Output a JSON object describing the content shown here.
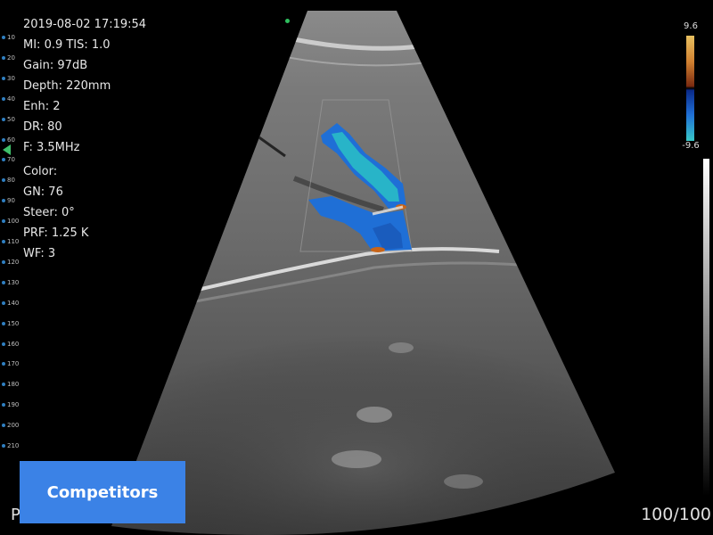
{
  "info_panel": {
    "datetime": "2019-08-02 17:19:54",
    "mi_tis": "MI: 0.9  TIS: 1.0",
    "gain": "Gain: 97dB",
    "depth": "Depth: 220mm",
    "enh": "Enh: 2",
    "dr": "DR: 80",
    "freq": "F: 3.5MHz",
    "color_heading": "Color:",
    "gn": "GN: 76",
    "steer": "Steer: 0°",
    "prf": "PRF: 1.25 K",
    "wf": "WF: 3"
  },
  "depth_scale": [
    "10",
    "20",
    "30",
    "40",
    "50",
    "60",
    "70",
    "80",
    "90",
    "100",
    "110",
    "120",
    "130",
    "140",
    "150",
    "160",
    "170",
    "180",
    "190",
    "200",
    "210"
  ],
  "color_scale": {
    "top": "9.6",
    "bottom": "-9.6"
  },
  "badge": {
    "label": "Competitors"
  },
  "frame_counter": "100/100",
  "left_clipped_text": "P",
  "colors": {
    "badge_bg": "#3b82e6",
    "doppler_blue": "#1f6fd6",
    "doppler_cyan": "#28b4c8",
    "doppler_orange": "#c86418",
    "focus_marker": "#3fbf6a"
  }
}
